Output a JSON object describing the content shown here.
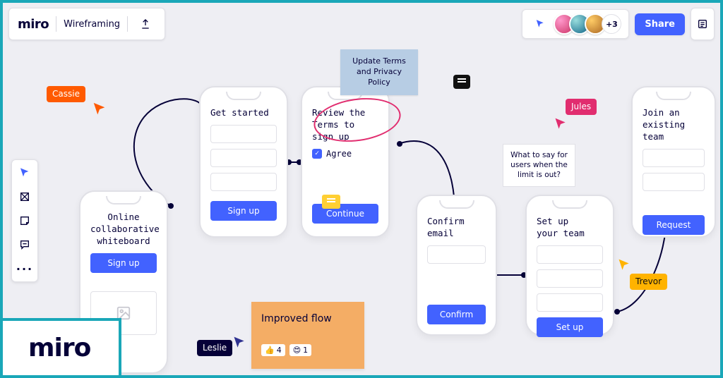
{
  "brand": "miro",
  "board_name": "Wireframing",
  "share_label": "Share",
  "extra_avatars": "+3",
  "users": {
    "cassie": "Cassie",
    "leslie": "Leslie",
    "jules": "Jules",
    "trevor": "Trevor"
  },
  "phones": {
    "intro": {
      "title": "Online\ncollaborative\nwhiteboard",
      "btn": "Sign up"
    },
    "started": {
      "title": "Get started",
      "btn": "Sign up"
    },
    "review": {
      "title": "Review the\nTerms to\nsign up",
      "agree": "Agree",
      "btn": "Continue"
    },
    "confirm": {
      "title": "Confirm\nemail",
      "btn": "Confirm"
    },
    "setup": {
      "title": "Set up\nyour team",
      "btn": "Set up"
    },
    "join": {
      "title": "Join an\nexisting\nteam",
      "btn": "Request"
    }
  },
  "sticky_update": "Update Terms and Privacy Policy",
  "note_limit": "What to say for users when the limit is out?",
  "improved": {
    "title": "Improved flow",
    "react1_emoji": "👍",
    "react1_count": "4",
    "react2_emoji": "😍",
    "react2_count": "1"
  }
}
